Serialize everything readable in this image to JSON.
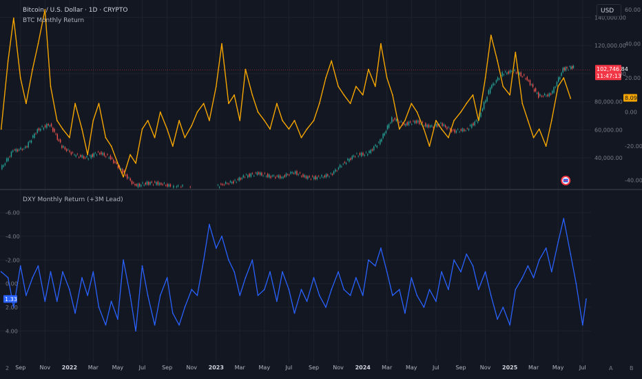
{
  "header": {
    "symbol_title": "Bitcoin / U.S. Dollar · 1D · CRYPTO",
    "currency": "USD"
  },
  "pane1": {
    "indicator_label": "BTC Monthly Return"
  },
  "pane2": {
    "indicator_label": "DXY Monthly Return (+3M Lead)"
  },
  "price_badge": {
    "value": "102,746.84",
    "countdown": "11:47:13",
    "color": "#f23645"
  },
  "btc_return_badge": {
    "value": "8.09",
    "color": "#f7a600"
  },
  "dxy_badge": {
    "value": "1.33",
    "color": "#2962ff"
  },
  "colors": {
    "background": "#131722",
    "btc_return": "#f7a600",
    "dxy_return": "#2962ff",
    "candle_up": "#26a69a",
    "candle_down": "#ef5350"
  },
  "corner_labels": {
    "left": "2",
    "right_a": "A",
    "right_b": "B"
  },
  "chart_data": [
    {
      "type": "line",
      "title": "BTC Monthly Return",
      "right_axis_ticks": [
        "60.00",
        "40.00",
        "20.00",
        "0.00",
        "-20.00",
        "-40.00"
      ],
      "ylim": [
        -45,
        62
      ],
      "price_axis_ticks": [
        "140,000.00",
        "120,000.00",
        "100,000.00",
        "80,000.00",
        "60,000.00",
        "40,000.00"
      ],
      "price_ylim": [
        18000,
        148000
      ],
      "series": [
        {
          "name": "BTC Monthly Return",
          "x": [
            "2021-07-15",
            "2021-08-01",
            "2021-08-15",
            "2021-09-01",
            "2021-09-15",
            "2021-10-01",
            "2021-10-15",
            "2021-11-01",
            "2021-11-15",
            "2021-12-01",
            "2021-12-15",
            "2022-01-01",
            "2022-01-15",
            "2022-02-01",
            "2022-02-15",
            "2022-03-01",
            "2022-03-15",
            "2022-04-01",
            "2022-04-15",
            "2022-05-01",
            "2022-05-15",
            "2022-06-01",
            "2022-06-15",
            "2022-07-01",
            "2022-07-15",
            "2022-08-01",
            "2022-08-15",
            "2022-09-01",
            "2022-09-15",
            "2022-10-01",
            "2022-10-15",
            "2022-11-01",
            "2022-11-15",
            "2022-12-01",
            "2022-12-15",
            "2023-01-01",
            "2023-01-15",
            "2023-02-01",
            "2023-02-15",
            "2023-03-01",
            "2023-03-15",
            "2023-04-01",
            "2023-04-15",
            "2023-05-01",
            "2023-05-15",
            "2023-06-01",
            "2023-06-15",
            "2023-07-01",
            "2023-07-15",
            "2023-08-01",
            "2023-08-15",
            "2023-09-01",
            "2023-09-15",
            "2023-10-01",
            "2023-10-15",
            "2023-11-01",
            "2023-11-15",
            "2023-12-01",
            "2023-12-15",
            "2024-01-01",
            "2024-01-15",
            "2024-02-01",
            "2024-02-15",
            "2024-03-01",
            "2024-03-15",
            "2024-04-01",
            "2024-04-15",
            "2024-05-01",
            "2024-05-15",
            "2024-06-01",
            "2024-06-15",
            "2024-07-01",
            "2024-07-15",
            "2024-08-01",
            "2024-08-15",
            "2024-09-01",
            "2024-09-15",
            "2024-10-01",
            "2024-10-15",
            "2024-11-01",
            "2024-11-15",
            "2024-12-01",
            "2024-12-15",
            "2025-01-01",
            "2025-01-15",
            "2025-02-01",
            "2025-02-15",
            "2025-03-01",
            "2025-03-15",
            "2025-04-01",
            "2025-04-15",
            "2025-05-01",
            "2025-05-15",
            "2025-06-01"
          ],
          "values": [
            -10,
            30,
            55,
            20,
            5,
            25,
            40,
            60,
            15,
            -5,
            -10,
            -15,
            5,
            -10,
            -25,
            -5,
            5,
            -15,
            -20,
            -30,
            -38,
            -25,
            -30,
            -10,
            -5,
            -15,
            0,
            -10,
            -20,
            -5,
            -15,
            -8,
            0,
            5,
            -5,
            15,
            40,
            5,
            10,
            -5,
            25,
            10,
            0,
            -5,
            -10,
            5,
            -5,
            -10,
            -5,
            -15,
            -10,
            -5,
            5,
            20,
            30,
            15,
            10,
            5,
            15,
            10,
            25,
            15,
            40,
            20,
            10,
            -10,
            -5,
            5,
            0,
            -10,
            -20,
            -5,
            -10,
            -15,
            -5,
            0,
            5,
            10,
            -5,
            20,
            45,
            30,
            15,
            10,
            35,
            5,
            -5,
            -15,
            -10,
            -20,
            -5,
            15,
            20,
            8
          ]
        }
      ],
      "price_series": {
        "name": "BTC/USD",
        "x": [
          "2021-07-15",
          "2021-08-15",
          "2021-09-15",
          "2021-10-15",
          "2021-11-15",
          "2021-12-15",
          "2022-01-15",
          "2022-02-15",
          "2022-03-15",
          "2022-04-15",
          "2022-05-15",
          "2022-06-15",
          "2022-07-15",
          "2022-08-15",
          "2022-09-15",
          "2022-10-15",
          "2022-11-15",
          "2022-12-15",
          "2023-01-15",
          "2023-02-15",
          "2023-03-15",
          "2023-04-15",
          "2023-05-15",
          "2023-06-15",
          "2023-07-15",
          "2023-08-15",
          "2023-09-15",
          "2023-10-15",
          "2023-11-15",
          "2023-12-15",
          "2024-01-15",
          "2024-02-15",
          "2024-03-15",
          "2024-04-15",
          "2024-05-15",
          "2024-06-15",
          "2024-07-15",
          "2024-08-15",
          "2024-09-15",
          "2024-10-15",
          "2024-11-15",
          "2024-12-15",
          "2025-01-15",
          "2025-02-15",
          "2025-03-15",
          "2025-04-15",
          "2025-05-15",
          "2025-06-10"
        ],
        "values": [
          32000,
          45000,
          47000,
          60000,
          64000,
          48000,
          42000,
          40000,
          44000,
          40000,
          30000,
          20000,
          22000,
          22000,
          19500,
          19500,
          16800,
          16800,
          21000,
          23000,
          27000,
          29000,
          27000,
          26500,
          30000,
          26000,
          26000,
          28000,
          36000,
          42000,
          43000,
          52000,
          68000,
          64000,
          66000,
          62000,
          64000,
          59000,
          60000,
          67000,
          90000,
          100000,
          102000,
          96000,
          84000,
          85000,
          103000,
          105000
        ]
      }
    },
    {
      "type": "line",
      "title": "DXY Monthly Return (+3M Lead)",
      "inverted_axis": true,
      "right_axis_ticks": [
        "-6.00",
        "-4.00",
        "-2.00",
        "0.00",
        "2.00",
        "4.00"
      ],
      "ylim": [
        -6.5,
        5.5
      ],
      "series": [
        {
          "name": "DXY Monthly Return (+3M Lead)",
          "x": [
            "2021-07-15",
            "2021-08-01",
            "2021-08-15",
            "2021-09-01",
            "2021-09-15",
            "2021-10-01",
            "2021-10-15",
            "2021-11-01",
            "2021-11-15",
            "2021-12-01",
            "2021-12-15",
            "2022-01-01",
            "2022-01-15",
            "2022-02-01",
            "2022-02-15",
            "2022-03-01",
            "2022-03-15",
            "2022-04-01",
            "2022-04-15",
            "2022-05-01",
            "2022-05-15",
            "2022-06-01",
            "2022-06-15",
            "2022-07-01",
            "2022-07-15",
            "2022-08-01",
            "2022-08-15",
            "2022-09-01",
            "2022-09-15",
            "2022-10-01",
            "2022-10-15",
            "2022-11-01",
            "2022-11-15",
            "2022-12-01",
            "2022-12-15",
            "2023-01-01",
            "2023-01-15",
            "2023-02-01",
            "2023-02-15",
            "2023-03-01",
            "2023-03-15",
            "2023-04-01",
            "2023-04-15",
            "2023-05-01",
            "2023-05-15",
            "2023-06-01",
            "2023-06-15",
            "2023-07-01",
            "2023-07-15",
            "2023-08-01",
            "2023-08-15",
            "2023-09-01",
            "2023-09-15",
            "2023-10-01",
            "2023-10-15",
            "2023-11-01",
            "2023-11-15",
            "2023-12-01",
            "2023-12-15",
            "2024-01-01",
            "2024-01-15",
            "2024-02-01",
            "2024-02-15",
            "2024-03-01",
            "2024-03-15",
            "2024-04-01",
            "2024-04-15",
            "2024-05-01",
            "2024-05-15",
            "2024-06-01",
            "2024-06-15",
            "2024-07-01",
            "2024-07-15",
            "2024-08-01",
            "2024-08-15",
            "2024-09-01",
            "2024-09-15",
            "2024-10-01",
            "2024-10-15",
            "2024-11-01",
            "2024-11-15",
            "2024-12-01",
            "2024-12-15",
            "2025-01-01",
            "2025-01-15",
            "2025-02-01",
            "2025-02-15",
            "2025-03-01",
            "2025-03-15",
            "2025-04-01",
            "2025-04-15",
            "2025-05-01",
            "2025-05-15",
            "2025-06-01",
            "2025-06-15",
            "2025-07-01",
            "2025-07-10"
          ],
          "values": [
            -1,
            -0.5,
            2,
            -1.5,
            1,
            -0.5,
            -1.5,
            1.5,
            -1,
            1.5,
            -1,
            0.5,
            2.5,
            -0.5,
            1,
            -1,
            2,
            3.5,
            1.5,
            3,
            -2,
            1,
            4,
            -1.5,
            1,
            3.5,
            1,
            -0.5,
            2.5,
            3.5,
            2,
            0.5,
            1,
            -2,
            -5,
            -3,
            -4,
            -2,
            -1,
            1,
            -0.5,
            -2,
            1,
            0.5,
            -1,
            1.5,
            -1,
            0.5,
            2.5,
            0.5,
            1.5,
            -0.5,
            1,
            2,
            0.5,
            -1,
            0.5,
            1,
            -0.5,
            1,
            -2,
            -1.5,
            -3,
            -1,
            1,
            0.5,
            2.5,
            -0.5,
            1,
            2,
            0.5,
            1.5,
            -1,
            0.5,
            -2,
            -1,
            -2.5,
            -1.5,
            0.5,
            -1,
            1,
            3,
            2,
            3.5,
            0.5,
            -0.5,
            -1.5,
            -0.5,
            -2,
            -3,
            -1,
            -3.5,
            -5.5,
            -2.5,
            0,
            3.5,
            1.3
          ]
        }
      ]
    }
  ],
  "time_axis": {
    "labels": [
      "Sep",
      "Nov",
      "2022",
      "Mar",
      "May",
      "Jul",
      "Sep",
      "Nov",
      "2023",
      "Mar",
      "May",
      "Jul",
      "Sep",
      "Nov",
      "2024",
      "Mar",
      "May",
      "Jul",
      "Sep",
      "Nov",
      "2025",
      "Mar",
      "May",
      "Jul"
    ],
    "dates": [
      "2021-09-01",
      "2021-11-01",
      "2022-01-01",
      "2022-03-01",
      "2022-05-01",
      "2022-07-01",
      "2022-09-01",
      "2022-11-01",
      "2023-01-01",
      "2023-03-01",
      "2023-05-01",
      "2023-07-01",
      "2023-09-01",
      "2023-11-01",
      "2024-01-01",
      "2024-03-01",
      "2024-05-01",
      "2024-07-01",
      "2024-09-01",
      "2024-11-01",
      "2025-01-01",
      "2025-03-01",
      "2025-05-01",
      "2025-07-01"
    ],
    "range": [
      "2021-07-12",
      "2025-07-22"
    ]
  }
}
